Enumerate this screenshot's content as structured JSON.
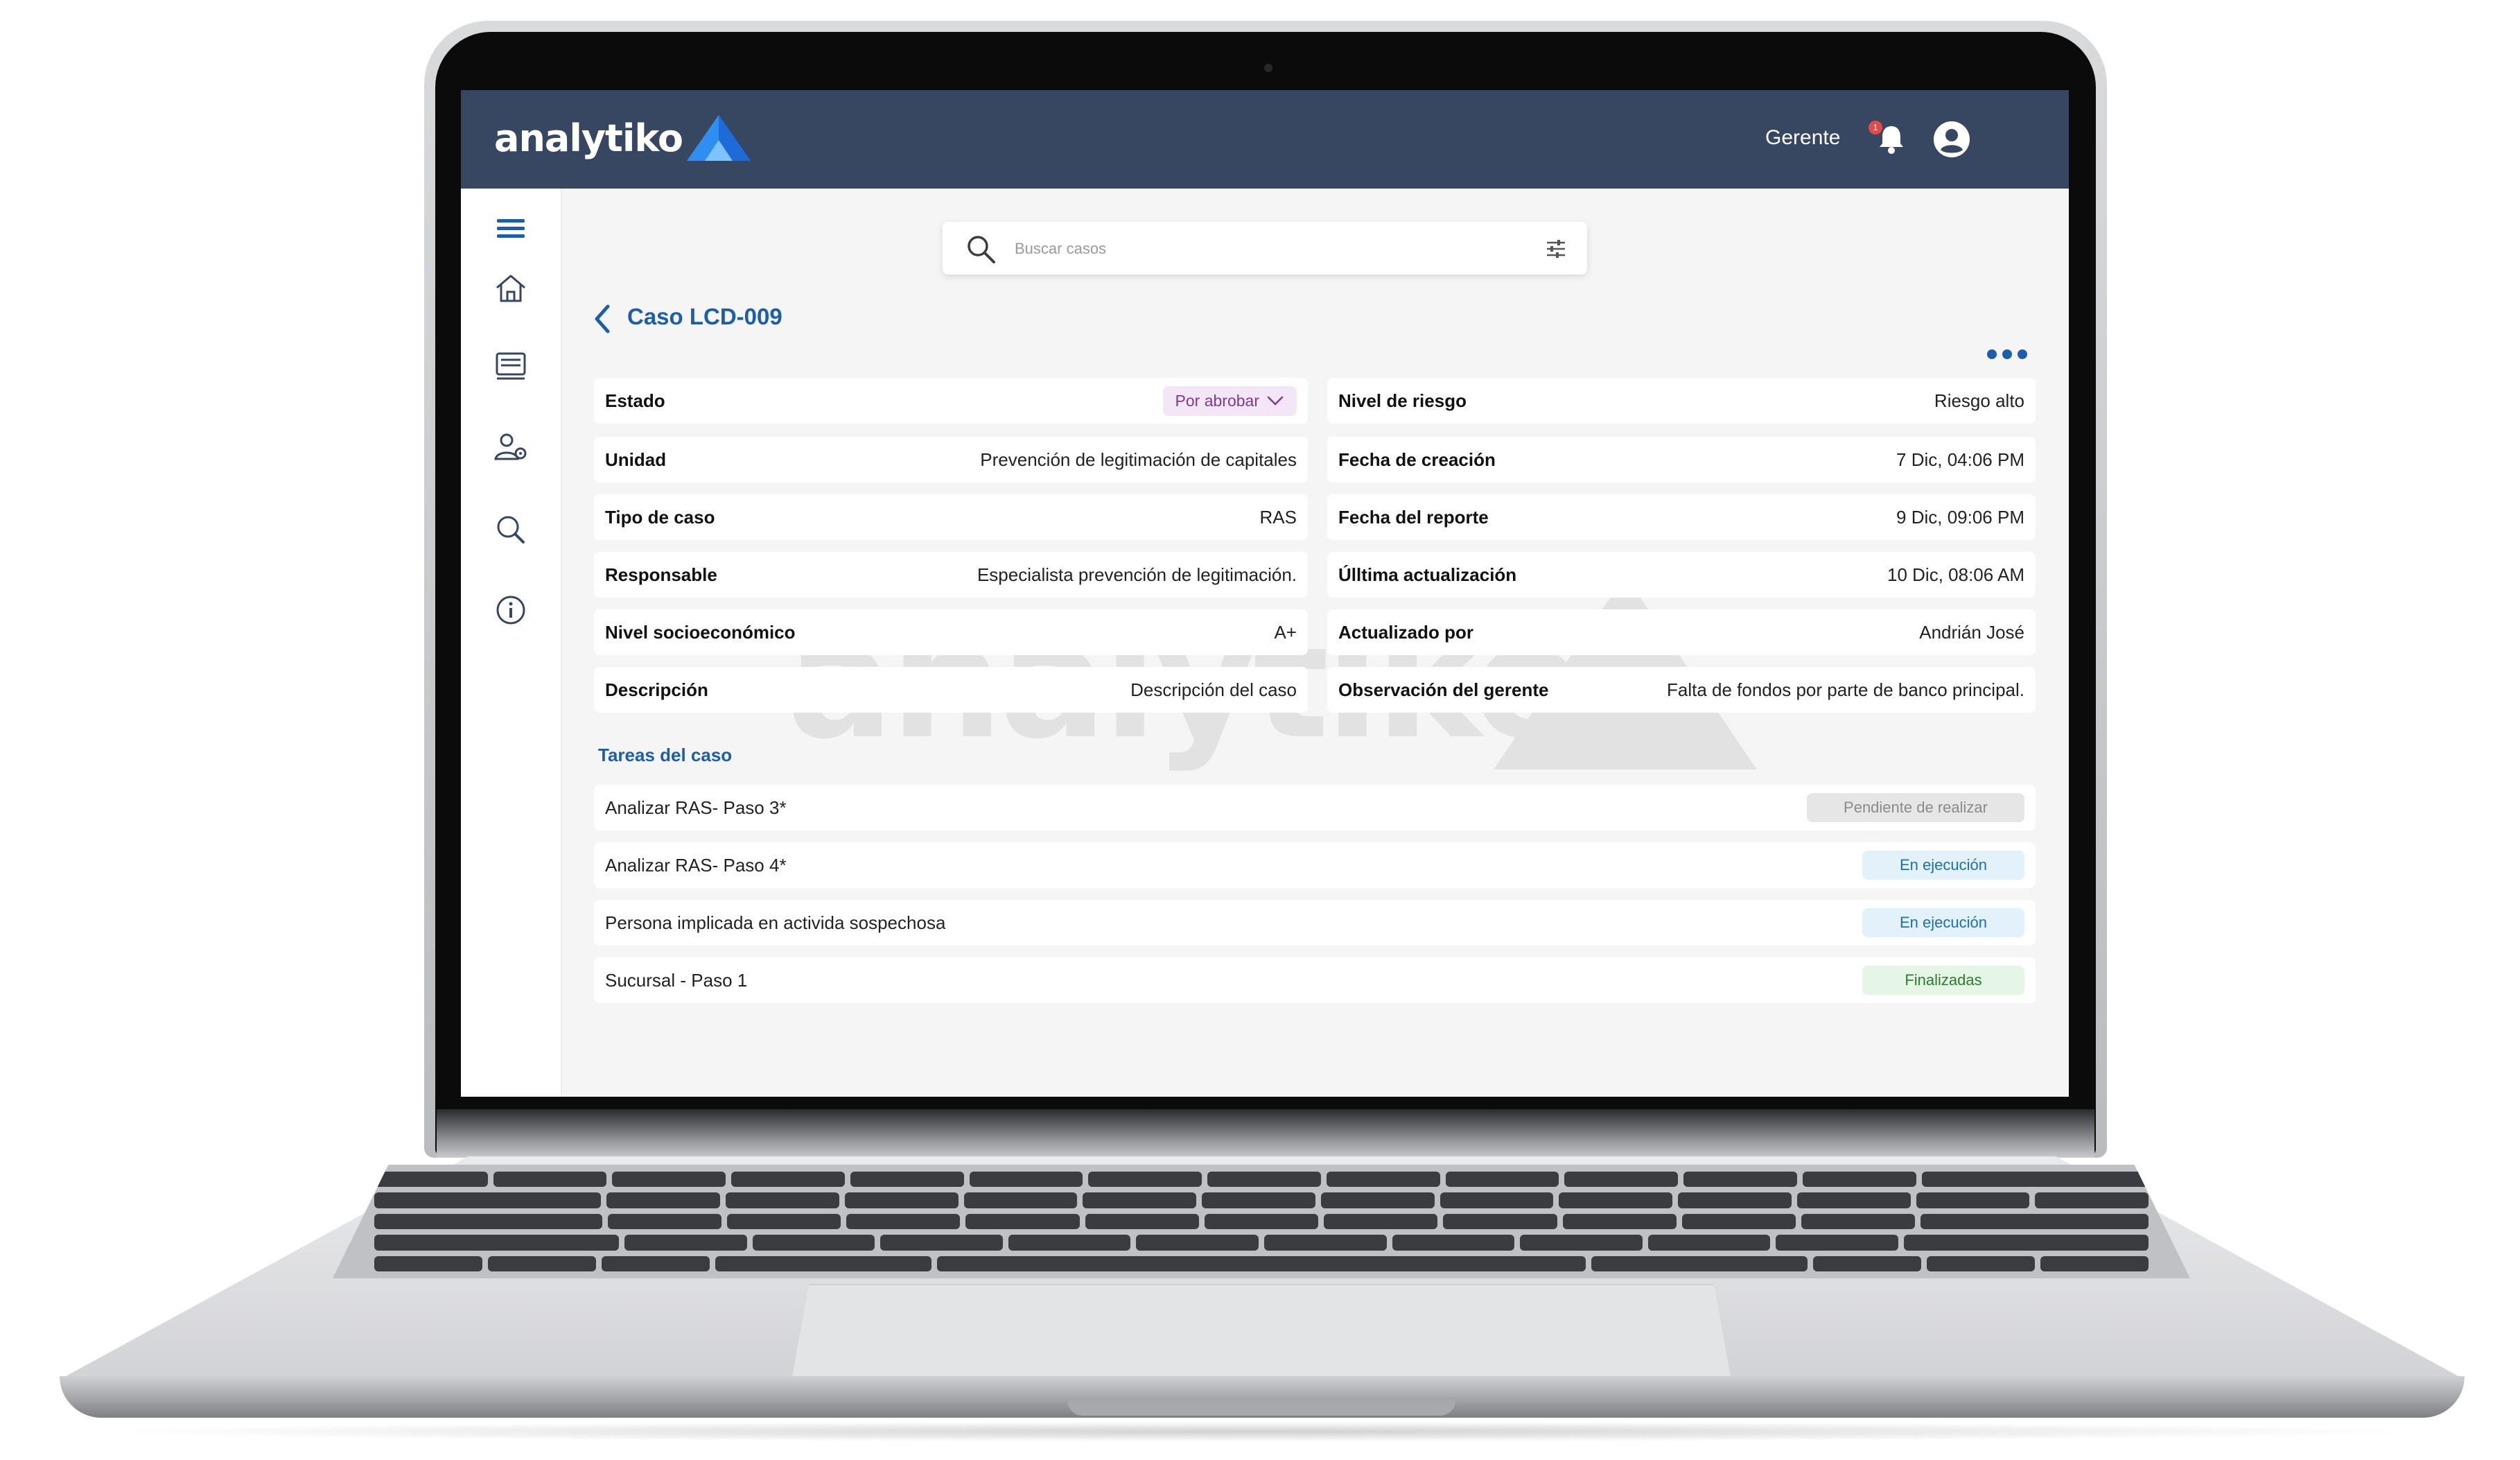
{
  "brand": {
    "name": "analytiko",
    "colors": {
      "topbar": "#374761",
      "accent": "#1c5ea8",
      "logo_blue": "#2f8ff0"
    }
  },
  "header": {
    "role_label": "Gerente",
    "notification_count": "1",
    "bell_icon": "bell-icon",
    "avatar_icon": "user-avatar-icon"
  },
  "sidebar": {
    "items": [
      {
        "icon": "menu-icon"
      },
      {
        "icon": "home-icon"
      },
      {
        "icon": "cases-icon"
      },
      {
        "icon": "users-settings-icon"
      },
      {
        "icon": "search-icon"
      },
      {
        "icon": "info-icon"
      }
    ]
  },
  "search": {
    "placeholder": "Buscar casos",
    "icon": "search-icon",
    "filter_icon": "filter-sliders-icon"
  },
  "case": {
    "title": "Caso LCD-009",
    "fields_left": [
      {
        "label": "Estado",
        "value": "Por abrobar",
        "type": "select"
      },
      {
        "label": "Unidad",
        "value": "Prevención de legitimación de capitales"
      },
      {
        "label": "Tipo de caso",
        "value": "RAS"
      },
      {
        "label": "Responsable",
        "value": "Especialista prevención de legitimación."
      },
      {
        "label": "Nivel socioeconómico",
        "value": "A+"
      },
      {
        "label": "Descripción",
        "value": "Descripción del caso"
      }
    ],
    "fields_right": [
      {
        "label": "Nivel de riesgo",
        "value": "Riesgo alto"
      },
      {
        "label": "Fecha de creación",
        "value": "7 Dic, 04:06 PM"
      },
      {
        "label": "Fecha del reporte",
        "value": "9 Dic, 09:06 PM"
      },
      {
        "label": "Úlltima actualización",
        "value": "10 Dic, 08:06 AM"
      },
      {
        "label": "Actualizado por",
        "value": "Andrián José"
      },
      {
        "label": "Observación del gerente",
        "value": "Falta de fondos por parte de banco principal."
      }
    ]
  },
  "tasks": {
    "title": "Tareas del caso",
    "items": [
      {
        "name": "Analizar RAS- Paso 3*",
        "status": "Pendiente de realizar",
        "kind": "pending"
      },
      {
        "name": "Analizar RAS- Paso 4*",
        "status": "En ejecución",
        "kind": "running"
      },
      {
        "name": "Persona implicada en activida sospechosa",
        "status": "En ejecución",
        "kind": "running"
      },
      {
        "name": "Sucursal - Paso 1",
        "status": "Finalizadas",
        "kind": "done"
      }
    ]
  }
}
